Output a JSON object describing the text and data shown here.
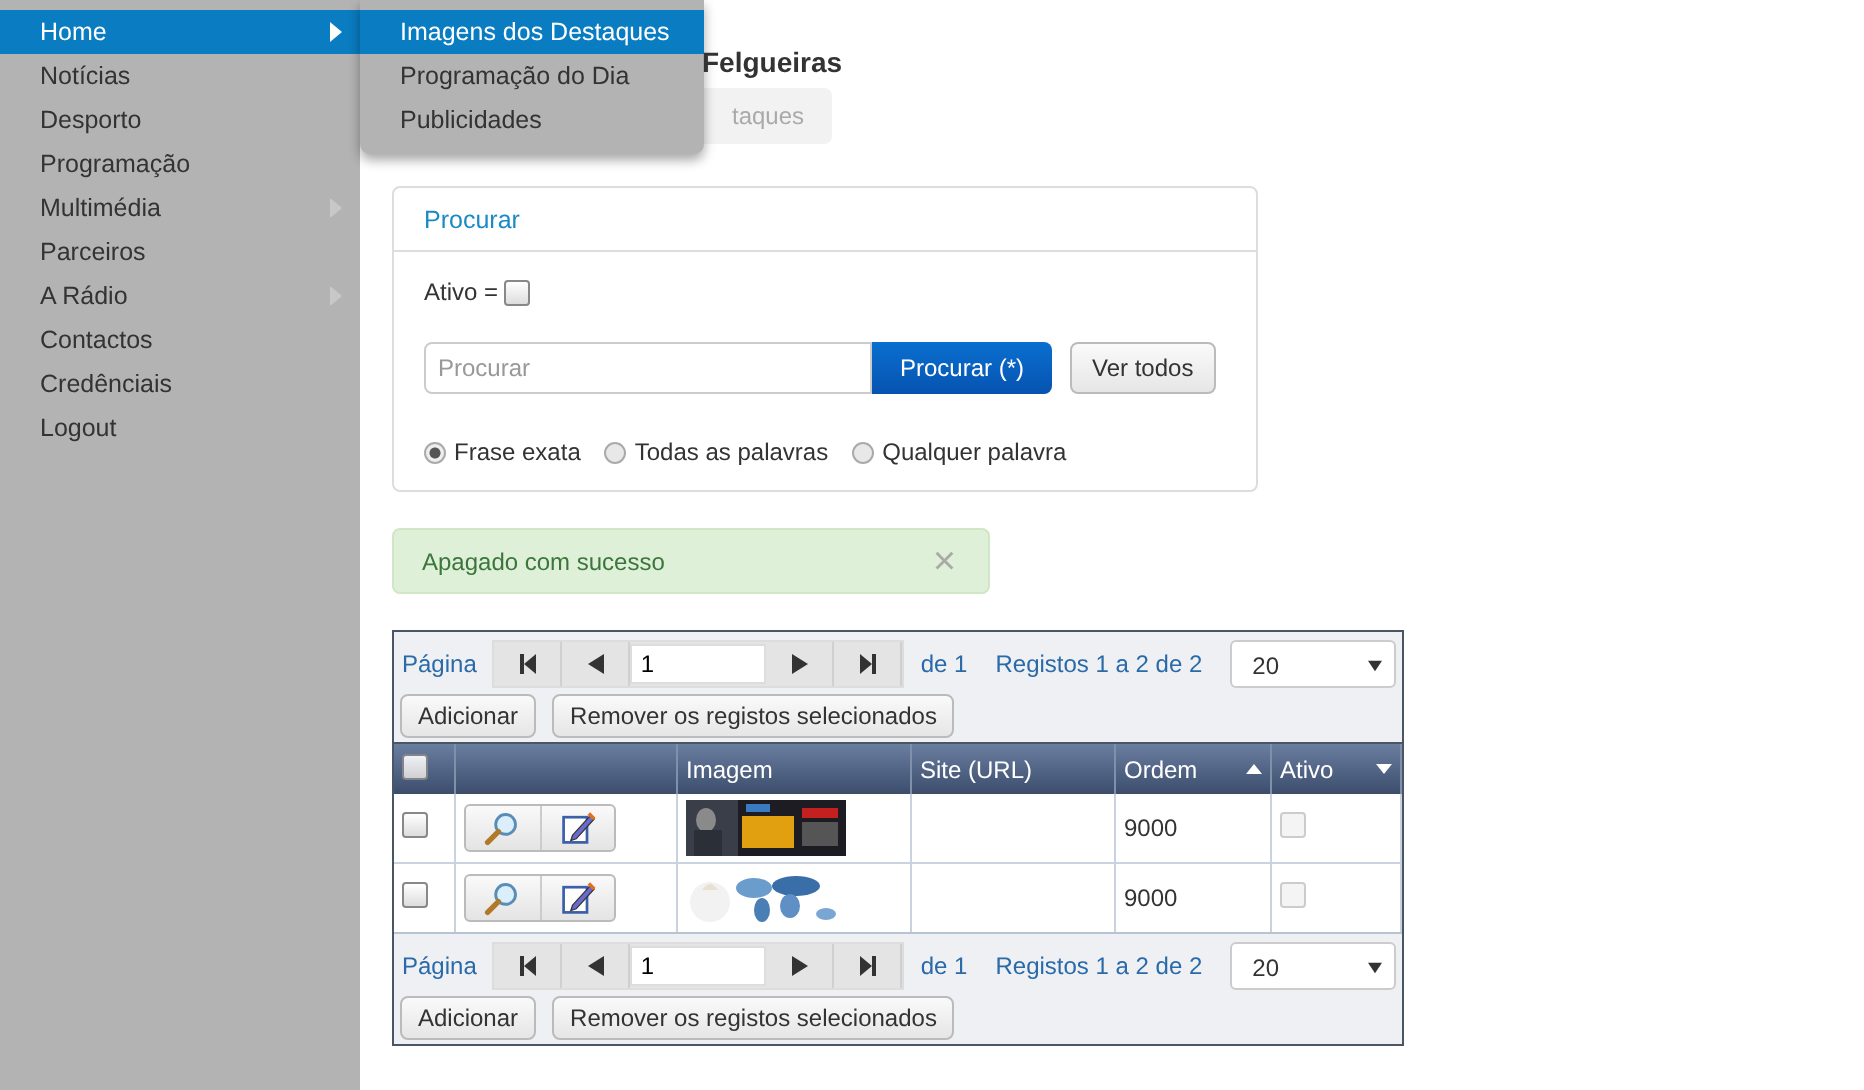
{
  "sidebar": {
    "items": [
      {
        "label": "Home",
        "selected": true,
        "has_submenu": true
      },
      {
        "label": "Notícias",
        "selected": false,
        "has_submenu": false
      },
      {
        "label": "Desporto",
        "selected": false,
        "has_submenu": false
      },
      {
        "label": "Programação",
        "selected": false,
        "has_submenu": false
      },
      {
        "label": "Multimédia",
        "selected": false,
        "has_submenu": true
      },
      {
        "label": "Parceiros",
        "selected": false,
        "has_submenu": false
      },
      {
        "label": "A Rádio",
        "selected": false,
        "has_submenu": true
      },
      {
        "label": "Contactos",
        "selected": false,
        "has_submenu": false
      },
      {
        "label": "Credênciais",
        "selected": false,
        "has_submenu": false
      },
      {
        "label": "Logout",
        "selected": false,
        "has_submenu": false
      }
    ]
  },
  "submenu": {
    "items": [
      {
        "label": "Imagens dos Destaques",
        "selected": true
      },
      {
        "label": "Programação do Dia",
        "selected": false
      },
      {
        "label": "Publicidades",
        "selected": false
      }
    ]
  },
  "page_title": "Felgueiras",
  "breadcrumb": "taques",
  "search_panel": {
    "title": "Procurar",
    "active_label": "Ativo =",
    "active_checked": false,
    "placeholder": "Procurar",
    "search_button": "Procurar (*)",
    "show_all_button": "Ver todos",
    "modes": [
      {
        "label": "Frase exata",
        "selected": true
      },
      {
        "label": "Todas as palavras",
        "selected": false
      },
      {
        "label": "Qualquer palavra",
        "selected": false
      }
    ]
  },
  "alert": {
    "message": "Apagado com sucesso",
    "close": "×"
  },
  "grid": {
    "pagers": [
      {
        "page_label": "Página",
        "page": "1",
        "of": "de 1",
        "records": "Registos 1 a 2 de 2",
        "page_size": "20",
        "add_button": "Adicionar",
        "remove_button": "Remover os registos selecionados"
      },
      {
        "page_label": "Página",
        "page": "1",
        "of": "de 1",
        "records": "Registos 1 a 2 de 2",
        "page_size": "20",
        "add_button": "Adicionar",
        "remove_button": "Remover os registos selecionados"
      }
    ],
    "select_all_checked": false,
    "columns": [
      {
        "kind": "checkbox"
      },
      {
        "kind": "blank"
      },
      {
        "kind": "plain",
        "label": "Imagem"
      },
      {
        "kind": "plain",
        "label": "Site (URL)"
      },
      {
        "kind": "ascending",
        "label": "Ordem"
      },
      {
        "kind": "descending",
        "label": "Ativo"
      }
    ],
    "rows": [
      {
        "checked": false,
        "order": "9000",
        "active": false
      },
      {
        "checked": false,
        "order": "9000",
        "active": false
      }
    ]
  }
}
